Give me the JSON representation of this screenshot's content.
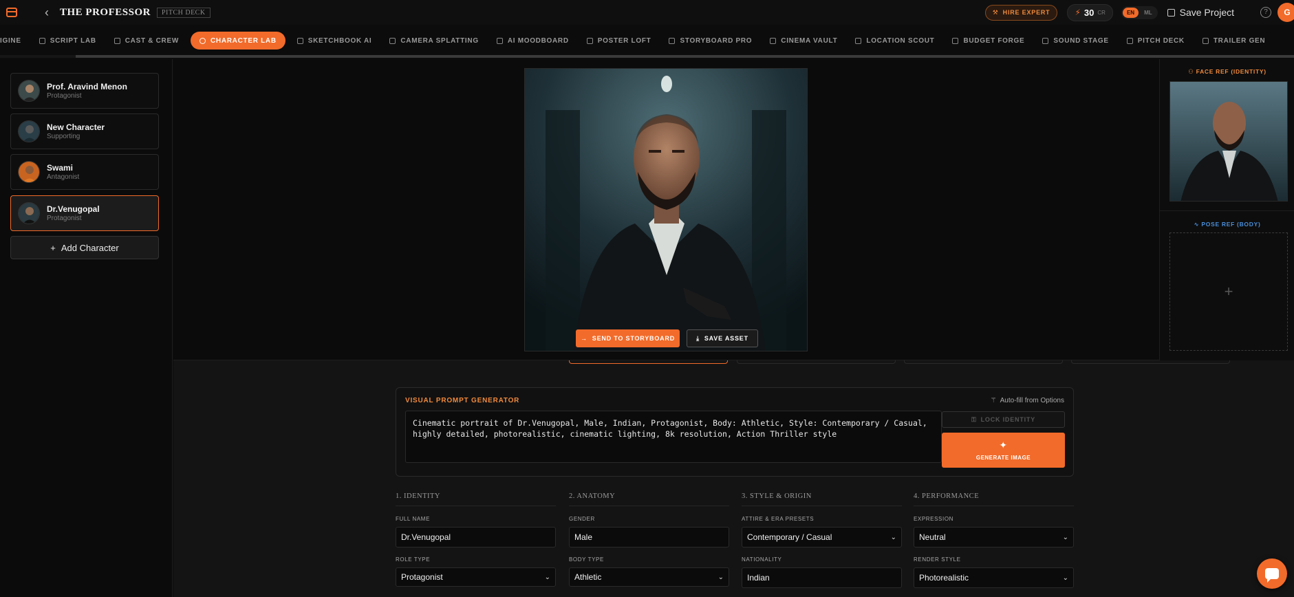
{
  "header": {
    "title": "THE PROFESSOR",
    "deck_tag": "PITCH DECK",
    "hire_expert": "HIRE EXPERT",
    "credits": "30",
    "credits_unit": "CR",
    "lang_en": "EN",
    "lang_ml": "ML",
    "save_project": "Save Project",
    "user_initial": "G"
  },
  "tabs": [
    {
      "label": "IGINE"
    },
    {
      "label": "SCRIPT LAB"
    },
    {
      "label": "CAST & CREW"
    },
    {
      "label": "CHARACTER LAB",
      "active": true
    },
    {
      "label": "SKETCHBOOK AI"
    },
    {
      "label": "CAMERA SPLATTING"
    },
    {
      "label": "AI MOODBOARD"
    },
    {
      "label": "POSTER LOFT"
    },
    {
      "label": "STORYBOARD PRO"
    },
    {
      "label": "CINEMA VAULT"
    },
    {
      "label": "LOCATION SCOUT"
    },
    {
      "label": "BUDGET FORGE"
    },
    {
      "label": "SOUND STAGE"
    },
    {
      "label": "PITCH DECK"
    },
    {
      "label": "TRAILER GEN"
    }
  ],
  "characters": [
    {
      "name": "Prof. Aravind Menon",
      "role": "Protagonist"
    },
    {
      "name": "New Character",
      "role": "Supporting"
    },
    {
      "name": "Swami",
      "role": "Antagonist"
    },
    {
      "name": "Dr.Venugopal",
      "role": "Protagonist",
      "active": true
    }
  ],
  "add_character": "Add Character",
  "stage": {
    "send_to_storyboard": "SEND TO STORYBOARD",
    "save_asset": "SAVE ASSET"
  },
  "refs": {
    "face_label": "FACE REF (IDENTITY)",
    "pose_label": "POSE REF (BODY)",
    "pose_plus": "+"
  },
  "prompt_gen": {
    "title": "VISUAL PROMPT GENERATOR",
    "autofill": "Auto-fill from Options",
    "prompt_text": "Cinematic portrait of Dr.Venugopal, Male, Indian, Protagonist, Body: Athletic, Style: Contemporary / Casual, highly detailed, photorealistic, cinematic lighting, 8k resolution, Action Thriller style",
    "lock_identity": "LOCK IDENTITY",
    "generate_image": "GENERATE IMAGE"
  },
  "form": {
    "identity": {
      "heading": "1. IDENTITY",
      "full_name_label": "FULL NAME",
      "full_name": "Dr.Venugopal",
      "role_type_label": "ROLE TYPE",
      "role_type": "Protagonist"
    },
    "anatomy": {
      "heading": "2. ANATOMY",
      "gender_label": "GENDER",
      "gender": "Male",
      "body_type_label": "BODY TYPE",
      "body_type": "Athletic"
    },
    "style": {
      "heading": "3. STYLE & ORIGIN",
      "attire_label": "ATTIRE & ERA PRESETS",
      "attire": "Contemporary / Casual",
      "nationality_label": "NATIONALITY",
      "nationality": "Indian"
    },
    "performance": {
      "heading": "4. PERFORMANCE",
      "expression_label": "EXPRESSION",
      "expression": "Neutral",
      "render_style_label": "RENDER STYLE",
      "render_style": "Photorealistic"
    }
  },
  "colors": {
    "accent": "#f26b2a",
    "background": "#0c0c0c",
    "panel": "#141414"
  },
  "icons": {
    "logo": "clapperboard-icon",
    "back": "chevron-left-icon",
    "hire": "wrench-icon",
    "credits": "bolt-icon",
    "save": "disk-icon",
    "help": "help-circle-icon",
    "chat": "chat-bubble-icon"
  }
}
